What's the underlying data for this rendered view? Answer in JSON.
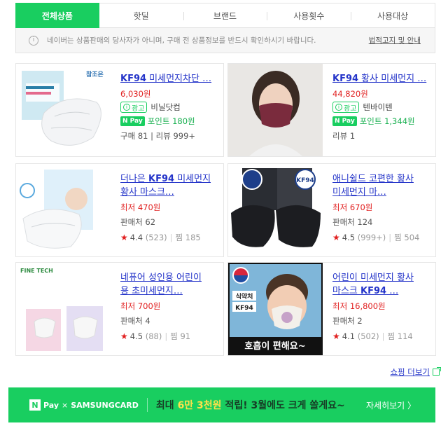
{
  "tabs": [
    "전체상품",
    "핫딜",
    "브랜드",
    "사용횟수",
    "사용대상"
  ],
  "notice": {
    "text": "네이버는 상품판매의 당사자가 아니며, 구매 전 상품정보를 반드시 확인하시기 바랍니다.",
    "link": "법적고지 및 안내"
  },
  "products": [
    {
      "title_kw": "KF94",
      "title_rest": " 미세먼지차단 …",
      "price": "6,030원",
      "ad_label": "광고",
      "seller": "비닐닷컴",
      "npay_point": "포인트 180원",
      "stats": "구매 81 | 리뷰 999+",
      "thumb_brand": "참조은"
    },
    {
      "title_kw": "KF94",
      "title_rest": " 황사 미세먼지 …",
      "price": "44,820원",
      "ad_label": "광고",
      "seller": "텐바이텐",
      "npay_point": "포인트 1,344원",
      "stats": "리뷰 1"
    },
    {
      "title_line1_pre": "더나은 ",
      "title_kw": "KF94",
      "title_line1_post": " 미세먼지",
      "title_line2": "황사 마스크…",
      "price": "최저 470원",
      "sellers": "판매처 62",
      "rating": "4.4",
      "reviews": "(523)",
      "likes": "찜 185"
    },
    {
      "title_line1": "애니쉴드 코편한 황사",
      "title_line2": "미세먼지 마…",
      "price": "최저 670원",
      "sellers": "판매처 124",
      "rating": "4.5",
      "reviews": "(999+)",
      "likes": "찜 504",
      "thumb_label": "KF94"
    },
    {
      "title_line1": "네퓨어 성인용 어린이",
      "title_line2": "용 초미세먼지…",
      "price": "최저 700원",
      "sellers": "판매처 4",
      "rating": "4.5",
      "reviews": "(88)",
      "likes": "찜 91",
      "thumb_brand": "FINE TECH"
    },
    {
      "title_line1": "어린이 미세먼지 황사",
      "title_line2_pre": "마스크 ",
      "title_kw": "KF94",
      "title_line2_post": " …",
      "price": "최저 16,800원",
      "sellers": "판매처 2",
      "rating": "4.1",
      "reviews": "(502)",
      "likes": "찜 114",
      "thumb_tag1": "식약처",
      "thumb_tag2": "KF94",
      "thumb_caption": "호흡이 편해요~"
    }
  ],
  "more_link": "쇼핑 더보기",
  "banner": {
    "npay": "Pay",
    "partner": "SAMSUNGCARD",
    "promo_pre": "최대 ",
    "promo_hl": "6만 3천원",
    "promo_mid": " 적립! 3월에도 크게 쏠게요~",
    "detail": "자세히보기 〉"
  },
  "colors": {
    "accent": "#19ce60",
    "link": "#2434c9",
    "price": "#e12020"
  }
}
